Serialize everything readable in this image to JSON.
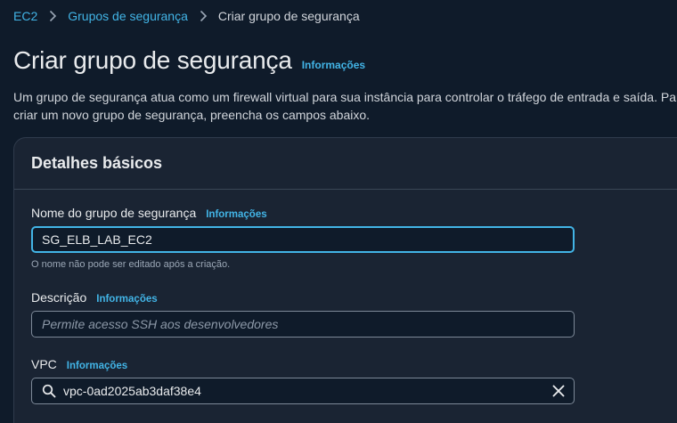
{
  "breadcrumb": {
    "items": [
      {
        "label": "EC2"
      },
      {
        "label": "Grupos de segurança"
      },
      {
        "label": "Criar grupo de segurança"
      }
    ]
  },
  "header": {
    "title": "Criar grupo de segurança",
    "info_label": "Informações",
    "description": "Um grupo de segurança atua como um firewall virtual para sua instância para controlar o tráfego de entrada e saída. Para criar um novo grupo de segurança, preencha os campos abaixo."
  },
  "basic_details": {
    "title": "Detalhes básicos",
    "name_field": {
      "label": "Nome do grupo de segurança",
      "info_label": "Informações",
      "value": "SG_ELB_LAB_EC2",
      "hint": "O nome não pode ser editado após a criação."
    },
    "description_field": {
      "label": "Descrição",
      "info_label": "Informações",
      "placeholder": "Permite acesso SSH aos desenvolvedores"
    },
    "vpc_field": {
      "label": "VPC",
      "info_label": "Informações",
      "value": "vpc-0ad2025ab3daf38e4"
    }
  },
  "colors": {
    "background": "#0f1b2a",
    "panel": "#1a2433",
    "link": "#42b4e6",
    "focus_border": "#42b4e6"
  },
  "icons": {
    "breadcrumb_separator": "chevron-right-icon",
    "search": "search-icon",
    "clear": "close-icon"
  }
}
